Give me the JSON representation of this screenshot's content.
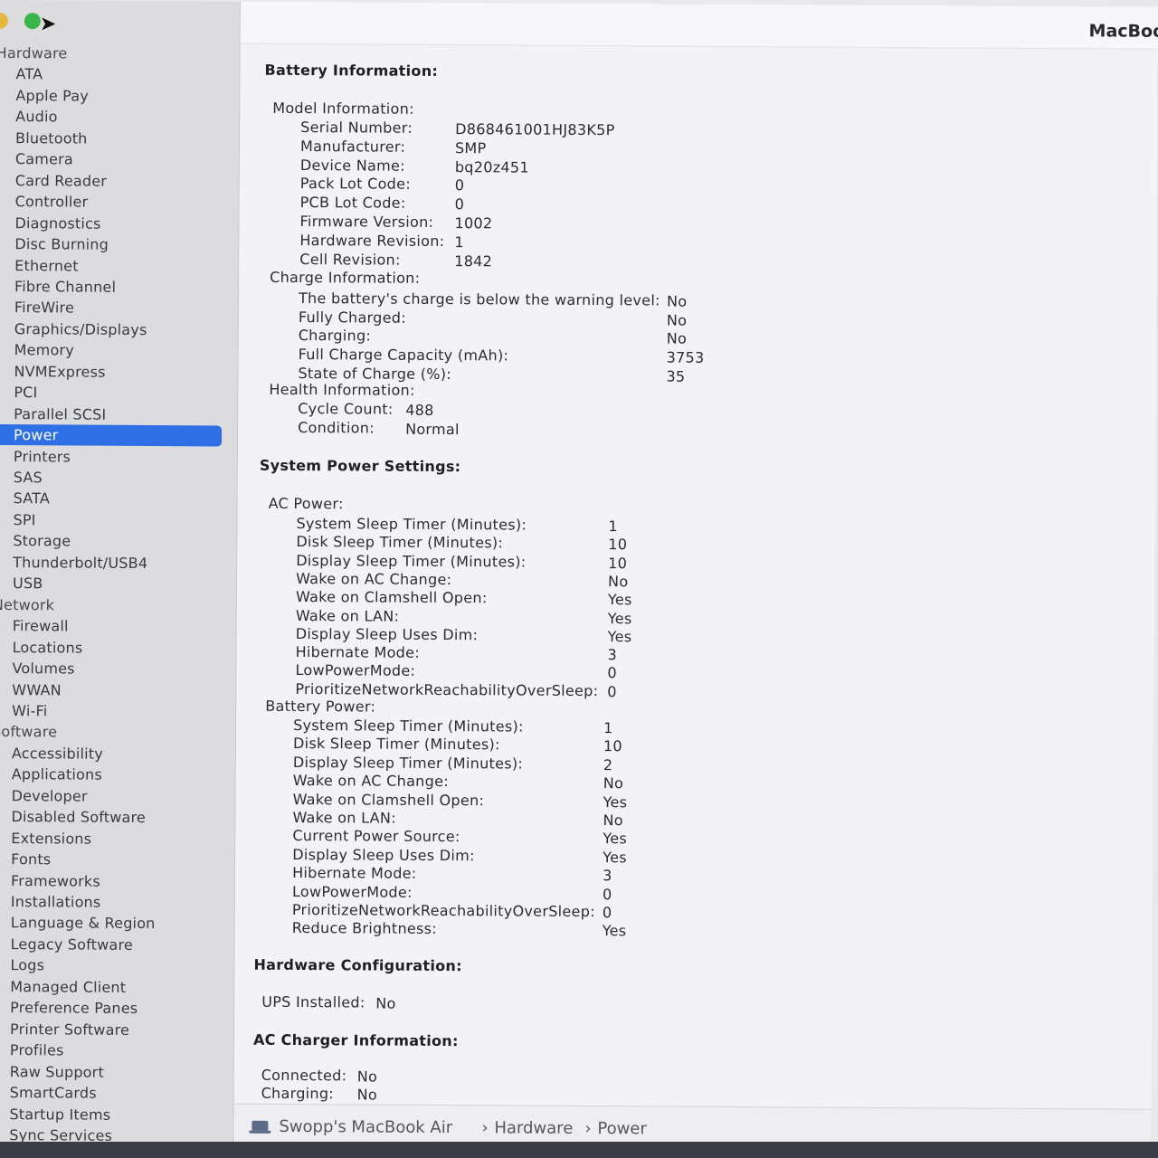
{
  "window": {
    "title": "MacBook"
  },
  "sidebar": {
    "items": [
      {
        "label": "Hardware",
        "header": true
      },
      {
        "label": "ATA"
      },
      {
        "label": "Apple Pay"
      },
      {
        "label": "Audio"
      },
      {
        "label": "Bluetooth"
      },
      {
        "label": "Camera"
      },
      {
        "label": "Card Reader"
      },
      {
        "label": "Controller"
      },
      {
        "label": "Diagnostics"
      },
      {
        "label": "Disc Burning"
      },
      {
        "label": "Ethernet"
      },
      {
        "label": "Fibre Channel"
      },
      {
        "label": "FireWire"
      },
      {
        "label": "Graphics/Displays"
      },
      {
        "label": "Memory"
      },
      {
        "label": "NVMExpress"
      },
      {
        "label": "PCI"
      },
      {
        "label": "Parallel SCSI"
      },
      {
        "label": "Power",
        "selected": true
      },
      {
        "label": "Printers"
      },
      {
        "label": "SAS"
      },
      {
        "label": "SATA"
      },
      {
        "label": "SPI"
      },
      {
        "label": "Storage"
      },
      {
        "label": "Thunderbolt/USB4"
      },
      {
        "label": "USB"
      },
      {
        "label": "Network",
        "header": true
      },
      {
        "label": "Firewall"
      },
      {
        "label": "Locations"
      },
      {
        "label": "Volumes"
      },
      {
        "label": "WWAN"
      },
      {
        "label": "Wi-Fi"
      },
      {
        "label": "Software",
        "header": true
      },
      {
        "label": "Accessibility"
      },
      {
        "label": "Applications"
      },
      {
        "label": "Developer"
      },
      {
        "label": "Disabled Software"
      },
      {
        "label": "Extensions"
      },
      {
        "label": "Fonts"
      },
      {
        "label": "Frameworks"
      },
      {
        "label": "Installations"
      },
      {
        "label": "Language & Region"
      },
      {
        "label": "Legacy Software"
      },
      {
        "label": "Logs"
      },
      {
        "label": "Managed Client"
      },
      {
        "label": "Preference Panes"
      },
      {
        "label": "Printer Software"
      },
      {
        "label": "Profiles"
      },
      {
        "label": "Raw Support"
      },
      {
        "label": "SmartCards"
      },
      {
        "label": "Startup Items"
      },
      {
        "label": "Sync Services"
      }
    ]
  },
  "battery": {
    "heading": "Battery Information:",
    "model_heading": "Model Information:",
    "model": [
      {
        "label": "Serial Number:",
        "value": "D868461001HJ83K5P"
      },
      {
        "label": "Manufacturer:",
        "value": "SMP"
      },
      {
        "label": "Device Name:",
        "value": "bq20z451"
      },
      {
        "label": "Pack Lot Code:",
        "value": "0"
      },
      {
        "label": "PCB Lot Code:",
        "value": "0"
      },
      {
        "label": "Firmware Version:",
        "value": "1002"
      },
      {
        "label": "Hardware Revision:",
        "value": "1"
      },
      {
        "label": "Cell Revision:",
        "value": "1842"
      }
    ],
    "charge_heading": "Charge Information:",
    "charge": [
      {
        "label": "The battery's charge is below the warning level:",
        "value": "No"
      },
      {
        "label": "Fully Charged:",
        "value": "No"
      },
      {
        "label": "Charging:",
        "value": "No"
      },
      {
        "label": "Full Charge Capacity (mAh):",
        "value": "3753"
      },
      {
        "label": "State of Charge (%):",
        "value": "35"
      }
    ],
    "health_heading": "Health Information:",
    "health": [
      {
        "label": "Cycle Count:",
        "value": "488"
      },
      {
        "label": "Condition:",
        "value": "Normal"
      }
    ]
  },
  "power_settings": {
    "heading": "System Power Settings:",
    "ac_heading": "AC Power:",
    "ac": [
      {
        "label": "System Sleep Timer (Minutes):",
        "value": "1"
      },
      {
        "label": "Disk Sleep Timer (Minutes):",
        "value": "10"
      },
      {
        "label": "Display Sleep Timer (Minutes):",
        "value": "10"
      },
      {
        "label": "Wake on AC Change:",
        "value": "No"
      },
      {
        "label": "Wake on Clamshell Open:",
        "value": "Yes"
      },
      {
        "label": "Wake on LAN:",
        "value": "Yes"
      },
      {
        "label": "Display Sleep Uses Dim:",
        "value": "Yes"
      },
      {
        "label": "Hibernate Mode:",
        "value": "3"
      },
      {
        "label": "LowPowerMode:",
        "value": "0"
      },
      {
        "label": "PrioritizeNetworkReachabilityOverSleep:",
        "value": "0"
      }
    ],
    "battery_heading": "Battery Power:",
    "battery": [
      {
        "label": "System Sleep Timer (Minutes):",
        "value": "1"
      },
      {
        "label": "Disk Sleep Timer (Minutes):",
        "value": "10"
      },
      {
        "label": "Display Sleep Timer (Minutes):",
        "value": "2"
      },
      {
        "label": "Wake on AC Change:",
        "value": "No"
      },
      {
        "label": "Wake on Clamshell Open:",
        "value": "Yes"
      },
      {
        "label": "Wake on LAN:",
        "value": "No"
      },
      {
        "label": "Current Power Source:",
        "value": "Yes"
      },
      {
        "label": "Display Sleep Uses Dim:",
        "value": "Yes"
      },
      {
        "label": "Hibernate Mode:",
        "value": "3"
      },
      {
        "label": "LowPowerMode:",
        "value": "0"
      },
      {
        "label": "PrioritizeNetworkReachabilityOverSleep:",
        "value": "0"
      },
      {
        "label": "Reduce Brightness:",
        "value": "Yes"
      }
    ]
  },
  "hardware_config": {
    "heading": "Hardware Configuration:",
    "ups_label": "UPS Installed:",
    "ups_value": "No"
  },
  "ac_charger": {
    "heading": "AC Charger Information:",
    "rows": [
      {
        "label": "Connected:",
        "value": "No"
      },
      {
        "label": "Charging:",
        "value": "No"
      }
    ]
  },
  "pathbar": {
    "icon": "laptop-icon",
    "computer": "Swopp's MacBook Air",
    "sep": "›",
    "section": "Hardware",
    "page": "Power"
  }
}
